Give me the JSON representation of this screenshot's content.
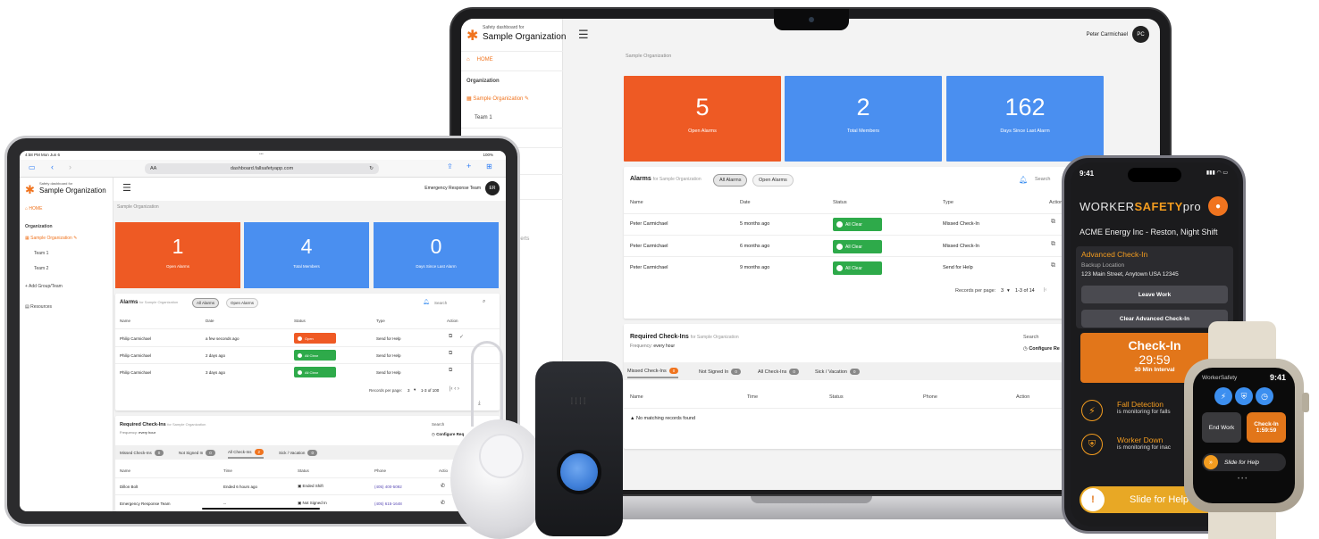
{
  "laptop": {
    "brand_small": "Safety dashboard for",
    "brand_org": "Sample Organization",
    "user_name": "Peter Carmichael",
    "user_initials": "PC",
    "nav_home": "HOME",
    "nav_org_label": "Organization",
    "nav_org_item": "Sample Organization",
    "nav_team1": "Team 1",
    "nav_alerts_partial": "lerts",
    "breadcrumb": "Sample Organization",
    "stats": [
      {
        "value": "5",
        "label": "Open Alarms",
        "color": "#ee5a24"
      },
      {
        "value": "2",
        "label": "Total Members",
        "color": "#4a8ff0"
      },
      {
        "value": "162",
        "label": "Days Since Last Alarm",
        "color": "#4a8ff0"
      }
    ],
    "alarms": {
      "title": "Alarms",
      "for": "for Sample Organization",
      "chip_all": "All Alarms",
      "chip_open": "Open Alarms",
      "search": "Search",
      "headers": [
        "Name",
        "Date",
        "Status",
        "Type",
        "Action"
      ],
      "rows": [
        {
          "name": "Peter Carmichael",
          "date": "5 months ago",
          "status": "All Clear",
          "type": "Missed Check-In"
        },
        {
          "name": "Peter Carmichael",
          "date": "6 months ago",
          "status": "All Clear",
          "type": "Missed Check-In"
        },
        {
          "name": "Peter Carmichael",
          "date": "9 months ago",
          "status": "All Clear",
          "type": "Send for Help"
        }
      ],
      "records_per_page": "Records per page:",
      "per_page": "3",
      "range": "1-3 of 14"
    },
    "checkins": {
      "title": "Required Check-Ins",
      "for": "for Sample Organization",
      "frequency_label": "Frequency:",
      "frequency": "every hour",
      "search": "Search",
      "configure": "Configure Re",
      "tabs": [
        {
          "label": "Missed Check-Ins",
          "count": "0"
        },
        {
          "label": "Not Signed In",
          "count": "0"
        },
        {
          "label": "All Check-Ins",
          "count": "0"
        },
        {
          "label": "Sick / Vacation",
          "count": "0"
        }
      ],
      "headers": [
        "Name",
        "Time",
        "Status",
        "Phone",
        "Action"
      ],
      "empty": "No matching records found"
    }
  },
  "tablet": {
    "status_time": "4:58 PM  Mon Jun 6",
    "status_batt": "100%",
    "url_aa": "AA",
    "url": "dashboard.fallsafetyapp.com",
    "brand_small": "Safety dashboard for",
    "brand_org": "Sample Organization",
    "team_name": "Emergency Response Team",
    "user_initials": "ER",
    "nav_home": "HOME",
    "nav_org_label": "Organization",
    "nav_org_item": "Sample Organization",
    "nav_team1": "Team 1",
    "nav_team2": "Team 2",
    "nav_add": "Add Group/Team",
    "nav_resources": "Resources",
    "breadcrumb": "Sample Organization",
    "stats": [
      {
        "value": "1",
        "label": "Open Alarms",
        "color": "#ee5a24"
      },
      {
        "value": "4",
        "label": "Total Members",
        "color": "#4a8ff0"
      },
      {
        "value": "0",
        "label": "Days Since Last Alarm",
        "color": "#4a8ff0"
      }
    ],
    "alarms": {
      "title": "Alarms",
      "for": "for Sample Organization",
      "chip_all": "All Alarms",
      "chip_open": "Open Alarms",
      "search": "Search",
      "headers": [
        "Name",
        "Date",
        "Status",
        "Type",
        "Action"
      ],
      "rows": [
        {
          "name": "Philip Carmichael",
          "date": "a few seconds ago",
          "status": "Open",
          "type": "Send for Help"
        },
        {
          "name": "Philip Carmichael",
          "date": "2 days ago",
          "status": "All Clear",
          "type": "Send for Help"
        },
        {
          "name": "Philip Carmichael",
          "date": "3 days ago",
          "status": "All Clear",
          "type": "Send for Help"
        }
      ],
      "records_per_page": "Records per page:",
      "per_page": "3",
      "range": "1-3 of 100"
    },
    "checkins": {
      "title": "Required Check-Ins",
      "for": "for Sample Organization",
      "frequency_label": "Frequency:",
      "frequency": "every hour",
      "search": "Search",
      "configure": "Configure Req",
      "tabs": [
        {
          "label": "Missed Check-Ins",
          "count": "0"
        },
        {
          "label": "Not Signed In",
          "count": "0"
        },
        {
          "label": "All Check-Ins",
          "count": "2"
        },
        {
          "label": "Sick / Vacation",
          "count": "0"
        }
      ],
      "headers": [
        "Name",
        "Time",
        "Status",
        "Phone",
        "Actio"
      ],
      "rows": [
        {
          "name": "Dillon Bolt",
          "time": "Ended 6 hours ago",
          "status": "Ended Shift",
          "phone": "(405) 400-5092"
        },
        {
          "name": "Emergency Response Team",
          "time": "--",
          "status": "Not Signed In",
          "phone": "(405) 615-1648"
        }
      ]
    }
  },
  "phone": {
    "time": "9:41",
    "title_left": "WORKER",
    "title_mid": "SAFETY",
    "title_right": "pro",
    "org": "ACME Energy Inc - Reston, Night Shift",
    "adv_title": "Advanced Check-In",
    "backup": "Backup Location",
    "address": "123 Main Street, Anytown USA 12345",
    "leave_work": "Leave Work",
    "clear_adv": "Clear Advanced Check-In",
    "checkin": "Check-In",
    "timer": "29:59",
    "interval": "30 Min Interval",
    "fall_title": "Fall Detection",
    "fall_sub": "is monitoring for falls",
    "down_title": "Worker Down",
    "down_sub": "is monitoring for inac",
    "slide": "Slide for Help"
  },
  "watch": {
    "title": "WorkerSafety",
    "time": "9:41",
    "end_work": "End Work",
    "checkin": "Check-In",
    "timer": "1:59:59",
    "slide": "Slide for Help"
  },
  "colors": {
    "accent_orange": "#f0741f",
    "blue": "#4a8ff0",
    "green": "#2eaa4a"
  }
}
